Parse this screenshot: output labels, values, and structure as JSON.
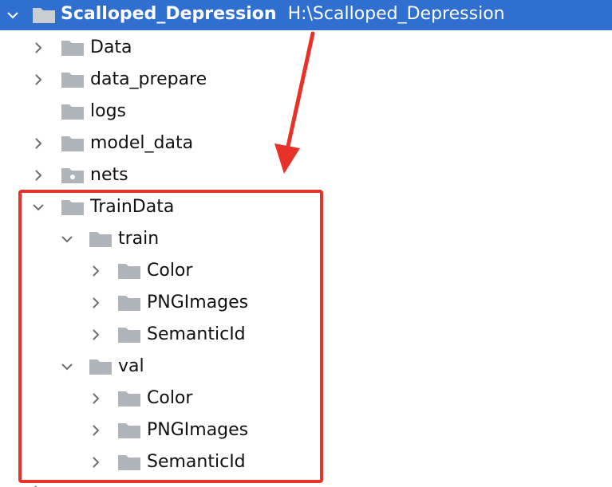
{
  "root": {
    "name": "Scalloped_Depression",
    "path": "H:\\Scalloped_Depression",
    "icon": "folder-icon",
    "expanded": true
  },
  "items": [
    {
      "label": "Data",
      "icon": "folder-icon",
      "chevron": "chevron-right-icon"
    },
    {
      "label": "data_prepare",
      "icon": "folder-icon",
      "chevron": "chevron-right-icon"
    },
    {
      "label": "logs",
      "icon": "folder-icon",
      "chevron": ""
    },
    {
      "label": "model_data",
      "icon": "folder-icon",
      "chevron": "chevron-right-icon"
    },
    {
      "label": "nets",
      "icon": "package-folder-icon",
      "chevron": "chevron-right-icon"
    },
    {
      "label": "TrainData",
      "icon": "folder-icon",
      "chevron": "chevron-down-icon"
    },
    {
      "label": "train",
      "icon": "folder-icon",
      "chevron": "chevron-down-icon"
    },
    {
      "label": "Color",
      "icon": "folder-icon",
      "chevron": "chevron-right-icon"
    },
    {
      "label": "PNGImages",
      "icon": "folder-icon",
      "chevron": "chevron-right-icon"
    },
    {
      "label": "SemanticId",
      "icon": "folder-icon",
      "chevron": "chevron-right-icon"
    },
    {
      "label": "val",
      "icon": "folder-icon",
      "chevron": "chevron-down-icon"
    },
    {
      "label": "Color",
      "icon": "folder-icon",
      "chevron": "chevron-right-icon"
    },
    {
      "label": "PNGImages",
      "icon": "folder-icon",
      "chevron": "chevron-right-icon"
    },
    {
      "label": "SemanticId",
      "icon": "folder-icon",
      "chevron": "chevron-right-icon"
    }
  ],
  "colors": {
    "selection": "#2f6fcf",
    "folder": "#aeb4b9",
    "chevron": "#6e6e6e",
    "annotation": "#e63228"
  },
  "annotation": {
    "box_icon": "highlight-box",
    "arrow_icon": "red-arrow-icon"
  }
}
